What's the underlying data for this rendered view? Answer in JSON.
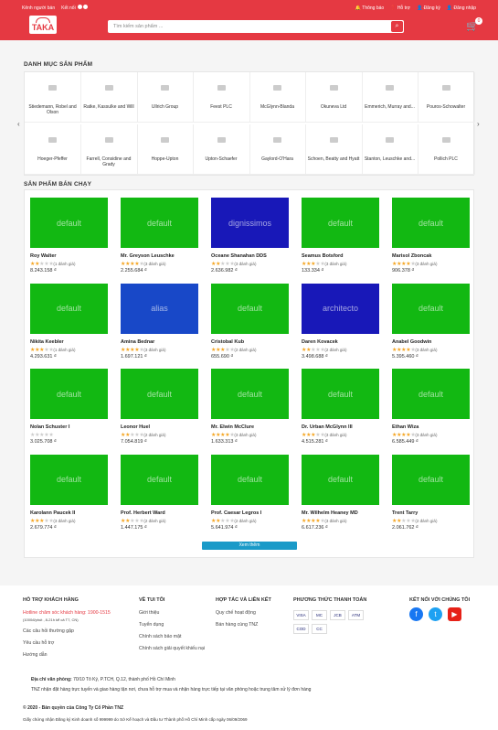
{
  "header": {
    "top_left": [
      "Kênh người bán",
      "Kết nối"
    ],
    "top_right": [
      "Thông báo",
      "Hỗ trợ",
      "Đăng ký",
      "Đăng nhập"
    ],
    "logo": "TAKA",
    "search_placeholder": "Tìm kiếm sản phẩm ...",
    "cart_count": "0"
  },
  "categories": {
    "title": "DANH MỤC SẢN PHẨM",
    "items": [
      "Stiedemann, Robel and Olson",
      "Ratke, Kassulke and Will",
      "Ullrich Group",
      "Feest PLC",
      "McGlynn-Blanda",
      "Okuneva Ltd",
      "Emmerich, Murray and...",
      "Pouros-Schowalter",
      "Hoeger-Pfeffer",
      "Farrell, Considine and Grady",
      "Hoppe-Upton",
      "Upton-Schaefer",
      "Gaylord-O'Hara",
      "Schoen, Beatty and Hyatt",
      "Stanton, Leuschke and...",
      "Pollich PLC"
    ]
  },
  "products": {
    "title": "SẢN PHẨM BÁN CHẠY",
    "items": [
      {
        "name": "Roy Walter",
        "reviews": "(1 đánh giá)",
        "price": "8.243.158 ₫",
        "img": "default",
        "color": "#12b812",
        "rating": 2
      },
      {
        "name": "Mr. Greyson Leuschke",
        "reviews": "(3 đánh giá)",
        "price": "2.255.684 ₫",
        "img": "default",
        "color": "#12b812",
        "rating": 4
      },
      {
        "name": "Oceane Shanahan DDS",
        "reviews": "(3 đánh giá)",
        "price": "2.636.982 ₫",
        "img": "dignissimos",
        "color": "#1818b8",
        "rating": 2
      },
      {
        "name": "Seamus Botsford",
        "reviews": "(3 đánh giá)",
        "price": "133.334 ₫",
        "img": "default",
        "color": "#12b812",
        "rating": 3
      },
      {
        "name": "Marisol Zboncak",
        "reviews": "(3 đánh giá)",
        "price": "906.378 ₫",
        "img": "default",
        "color": "#12b812",
        "rating": 4
      },
      {
        "name": "Nikita Keebler",
        "reviews": "(1 đánh giá)",
        "price": "4.293.631 ₫",
        "img": "default",
        "color": "#12b812",
        "rating": 3
      },
      {
        "name": "Amina Bednar",
        "reviews": "(3 đánh giá)",
        "price": "1.697.121 ₫",
        "img": "alias",
        "color": "#1848c8",
        "rating": 4
      },
      {
        "name": "Cristobal Kub",
        "reviews": "(2 đánh giá)",
        "price": "655.690 ₫",
        "img": "default",
        "color": "#12b812",
        "rating": 3
      },
      {
        "name": "Daren Kovacek",
        "reviews": "(2 đánh giá)",
        "price": "3.498.688 ₫",
        "img": "architecto",
        "color": "#1818b8",
        "rating": 2
      },
      {
        "name": "Anabel Goodwin",
        "reviews": "(3 đánh giá)",
        "price": "5.395.460 ₫",
        "img": "default",
        "color": "#12b812",
        "rating": 4
      },
      {
        "name": "Nolan Schuster I",
        "reviews": "",
        "price": "3.025.708 ₫",
        "img": "default",
        "color": "#12b812",
        "rating": 0
      },
      {
        "name": "Leonor Huel",
        "reviews": "(2 đánh giá)",
        "price": "7.054.819 ₫",
        "img": "default",
        "color": "#12b812",
        "rating": 2
      },
      {
        "name": "Mr. Elwin McClure",
        "reviews": "(3 đánh giá)",
        "price": "1.633.313 ₫",
        "img": "default",
        "color": "#12b812",
        "rating": 4
      },
      {
        "name": "Dr. Urban McGlynn III",
        "reviews": "(3 đánh giá)",
        "price": "4.515.281 ₫",
        "img": "default",
        "color": "#12b812",
        "rating": 3
      },
      {
        "name": "Ethan Wiza",
        "reviews": "(3 đánh giá)",
        "price": "6.585.449 ₫",
        "img": "default",
        "color": "#12b812",
        "rating": 4
      },
      {
        "name": "Karolann Paucek II",
        "reviews": "(3 đánh giá)",
        "price": "2.679.774 ₫",
        "img": "default",
        "color": "#12b812",
        "rating": 3
      },
      {
        "name": "Prof. Herbert Ward",
        "reviews": "(2 đánh giá)",
        "price": "1.447.175 ₫",
        "img": "default",
        "color": "#12b812",
        "rating": 2
      },
      {
        "name": "Prof. Caesar Legros I",
        "reviews": "(2 đánh giá)",
        "price": "5.641.974 ₫",
        "img": "default",
        "color": "#12b812",
        "rating": 2
      },
      {
        "name": "Mr. Wilhelm Heaney MD",
        "reviews": "(3 đánh giá)",
        "price": "6.617.236 ₫",
        "img": "default",
        "color": "#12b812",
        "rating": 4
      },
      {
        "name": "Trent Tarry",
        "reviews": "(2 đánh giá)",
        "price": "2.061.762 ₫",
        "img": "default",
        "color": "#12b812",
        "rating": 2
      }
    ],
    "more": "Xem thêm"
  },
  "footer": {
    "support": {
      "title": "HỖ TRỢ KHÁCH HÀNG",
      "hotline": "Hotline chăm sóc khách hàng: 1900-1515",
      "hotline_note": "(1000đ/phút , 8-21h kể cả T7, CN)",
      "items": [
        "Các câu hỏi thường gặp",
        "Yêu cầu hỗ trợ",
        "Hướng dẫn"
      ]
    },
    "about": {
      "title": "VỀ TUI TÔI",
      "items": [
        "Giới thiệu",
        "Tuyển dụng",
        "Chính sách bảo mật",
        "Chính sách giải quyết khiếu nại"
      ]
    },
    "partner": {
      "title": "HỢP TÁC VÀ LIÊN KẾT",
      "items": [
        "Quy chế hoạt động",
        "Bán hàng cùng TNZ"
      ]
    },
    "payment": {
      "title": "PHƯƠNG THỨC THANH TOÁN",
      "methods": [
        "VISA",
        "MC",
        "JCB",
        "ATM",
        "COD",
        "CC"
      ]
    },
    "connect": {
      "title": "KẾT NỐI VỚI CHÚNG TÔI"
    },
    "address_label": "Địa chỉ văn phòng:",
    "address": "70/10 Tô Ký, P.TCH, Q.12, thành phố Hồ Chí Minh",
    "note": "TNZ nhận đặt hàng trực tuyến và giao hàng tận nơi, chưa hỗ trợ mua và nhận hàng trực tiếp tại văn phòng hoặc trung tâm xử lý đơn hàng",
    "copyright": "© 2020 - Bản quyền của Công Ty Cổ Phần TNZ",
    "license": "Giấy chứng nhận Đăng ký Kinh doanh số 999999 do Sở Kế hoạch và Đầu tư Thành phố Hồ Chí Minh cấp ngày 06/09/2069"
  }
}
